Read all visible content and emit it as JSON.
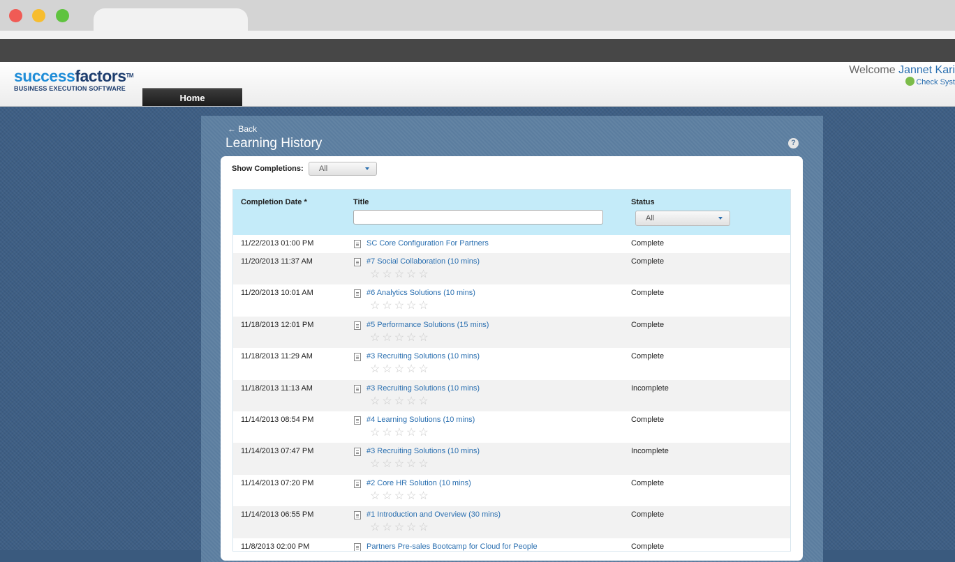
{
  "app": {
    "logo_success": "success",
    "logo_factors": "factors",
    "logo_tm": "TM",
    "logo_tagline": "BUSINESS EXECUTION SOFTWARE",
    "home_tab": "Home",
    "welcome_prefix": "Welcome",
    "welcome_user": "Jannet Kari",
    "check_system": "Check Syst"
  },
  "page": {
    "back": "← Back",
    "title": "Learning History",
    "help": "?",
    "show_label": "Show Completions:",
    "show_value": "All"
  },
  "table": {
    "headers": {
      "date": "Completion Date *",
      "title": "Title",
      "status": "Status"
    },
    "status_filter": "All",
    "stars": "☆☆☆☆☆",
    "rows": [
      {
        "date": "11/22/2013 01:00 PM",
        "title": "SC Core Configuration For Partners",
        "status": "Complete",
        "rated": false
      },
      {
        "date": "11/20/2013 11:37 AM",
        "title": "#7 Social Collaboration (10 mins)",
        "status": "Complete",
        "rated": true
      },
      {
        "date": "11/20/2013 10:01 AM",
        "title": "#6 Analytics Solutions (10 mins)",
        "status": "Complete",
        "rated": true
      },
      {
        "date": "11/18/2013 12:01 PM",
        "title": "#5 Performance Solutions (15 mins)",
        "status": "Complete",
        "rated": true
      },
      {
        "date": "11/18/2013 11:29 AM",
        "title": "#3 Recruiting Solutions (10 mins)",
        "status": "Complete",
        "rated": true
      },
      {
        "date": "11/18/2013 11:13 AM",
        "title": "#3 Recruiting Solutions (10 mins)",
        "status": "Incomplete",
        "rated": true
      },
      {
        "date": "11/14/2013 08:54 PM",
        "title": "#4 Learning Solutions (10 mins)",
        "status": "Complete",
        "rated": true
      },
      {
        "date": "11/14/2013 07:47 PM",
        "title": "#3 Recruiting Solutions (10 mins)",
        "status": "Incomplete",
        "rated": true
      },
      {
        "date": "11/14/2013 07:20 PM",
        "title": "#2 Core HR Solution (10 mins)",
        "status": "Complete",
        "rated": true
      },
      {
        "date": "11/14/2013 06:55 PM",
        "title": "#1 Introduction and Overview (30 mins)",
        "status": "Complete",
        "rated": true
      },
      {
        "date": "11/8/2013 02:00 PM",
        "title": "Partners Pre-sales Bootcamp for Cloud for People",
        "status": "Complete",
        "rated": false
      }
    ]
  }
}
